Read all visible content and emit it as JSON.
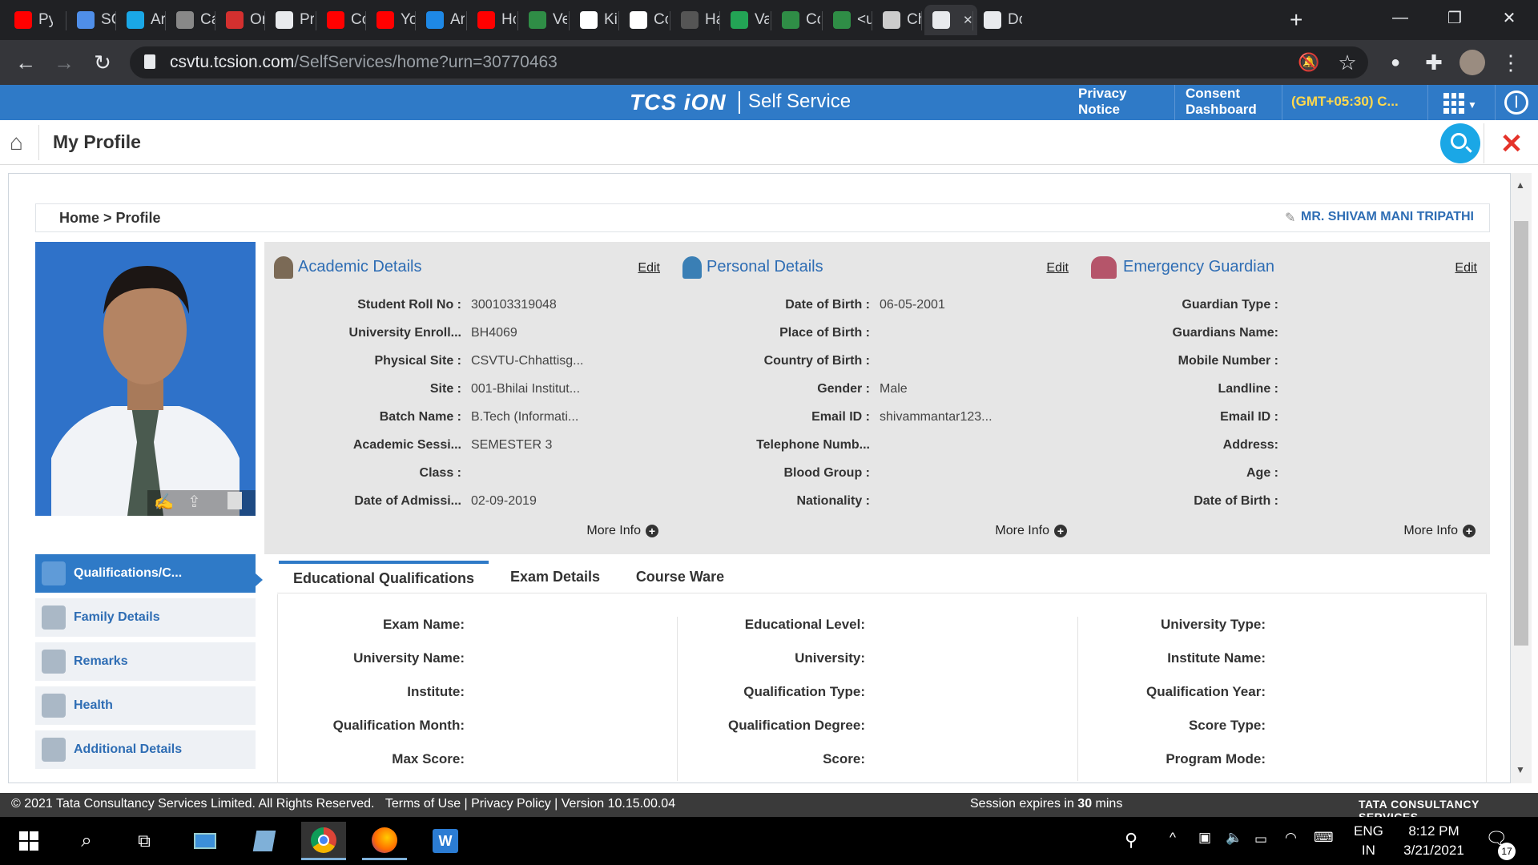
{
  "browser": {
    "tabs": [
      {
        "label": "Py",
        "color": "#ff0000"
      },
      {
        "label": "SC",
        "color": "#4f8ee8"
      },
      {
        "label": "Ar",
        "color": "#1aa7e6"
      },
      {
        "label": "Ca",
        "color": "#888888"
      },
      {
        "label": "Or",
        "color": "#d3302f"
      },
      {
        "label": "Pr",
        "color": "#e8eaed"
      },
      {
        "label": "Co",
        "color": "#ff0000"
      },
      {
        "label": "Yo",
        "color": "#ff0000"
      },
      {
        "label": "Ar",
        "color": "#1e88e5"
      },
      {
        "label": "Hc",
        "color": "#ff0000"
      },
      {
        "label": "Ve",
        "color": "#2f8d46"
      },
      {
        "label": "Ki",
        "color": "#ffffff"
      },
      {
        "label": "Cc",
        "color": "#ffffff"
      },
      {
        "label": "Ha",
        "color": "#555555"
      },
      {
        "label": "Va",
        "color": "#23a455"
      },
      {
        "label": "Cc",
        "color": "#2f8d46"
      },
      {
        "label": "<u",
        "color": "#2f8d46"
      },
      {
        "label": "Ch",
        "color": "#cccccc"
      },
      {
        "label": "",
        "color": "#e8eaed",
        "active": true
      },
      {
        "label": "Dc",
        "color": "#e8eaed"
      }
    ],
    "new_tab": "+",
    "window_controls": {
      "minimize": "—",
      "restore": "❐",
      "close": "✕"
    },
    "url_host": "csvtu.tcsion.com",
    "url_path": "/SelfServices/home?urn=30770463"
  },
  "header": {
    "brand": "TCS iON",
    "service": "Self Service",
    "privacy_line1": "Privacy",
    "privacy_line2": "Notice",
    "consent_line1": "Consent",
    "consent_line2": "Dashboard",
    "timezone": "(GMT+05:30) C..."
  },
  "page": {
    "title": "My Profile",
    "breadcrumb": "Home > Profile",
    "user": "MR. SHIVAM MANI TRIPATHI"
  },
  "panels": {
    "academic": {
      "title": "Academic Details",
      "edit": "Edit",
      "rows": [
        {
          "label": "Student Roll No :",
          "value": "300103319048"
        },
        {
          "label": "University Enroll...",
          "value": "BH4069"
        },
        {
          "label": "Physical Site :",
          "value": "CSVTU-Chhattisg..."
        },
        {
          "label": "Site :",
          "value": "001-Bhilai Institut..."
        },
        {
          "label": "Batch Name :",
          "value": "B.Tech (Informati..."
        },
        {
          "label": "Academic Sessi...",
          "value": "SEMESTER 3"
        },
        {
          "label": "Class :",
          "value": ""
        },
        {
          "label": "Date of Admissi...",
          "value": "02-09-2019"
        }
      ],
      "more": "More Info"
    },
    "personal": {
      "title": "Personal Details",
      "edit": "Edit",
      "rows": [
        {
          "label": "Date of Birth :",
          "value": "06-05-2001"
        },
        {
          "label": "Place of Birth :",
          "value": ""
        },
        {
          "label": "Country of Birth :",
          "value": ""
        },
        {
          "label": "Gender :",
          "value": "Male"
        },
        {
          "label": "Email ID :",
          "value": "shivammantar123..."
        },
        {
          "label": "Telephone Numb...",
          "value": ""
        },
        {
          "label": "Blood Group :",
          "value": ""
        },
        {
          "label": "Nationality :",
          "value": ""
        }
      ],
      "more": "More Info"
    },
    "guardian": {
      "title": "Emergency Guardian",
      "edit": "Edit",
      "rows": [
        {
          "label": "Guardian Type :",
          "value": ""
        },
        {
          "label": "Guardians Name:",
          "value": ""
        },
        {
          "label": "Mobile Number :",
          "value": ""
        },
        {
          "label": "Landline :",
          "value": ""
        },
        {
          "label": "Email ID :",
          "value": ""
        },
        {
          "label": "Address:",
          "value": ""
        },
        {
          "label": "Age :",
          "value": ""
        },
        {
          "label": "Date of Birth :",
          "value": ""
        }
      ],
      "more": "More Info"
    }
  },
  "sidenav": [
    {
      "label": "Qualifications/C...",
      "active": true
    },
    {
      "label": "Family Details"
    },
    {
      "label": "Remarks"
    },
    {
      "label": "Health"
    },
    {
      "label": "Additional Details"
    }
  ],
  "tabs": [
    "Educational Qualifications",
    "Exam Details",
    "Course Ware"
  ],
  "qualification_fields": [
    [
      "Exam Name:",
      "Educational Level:",
      "University Type:"
    ],
    [
      "University Name:",
      "University:",
      "Institute Name:"
    ],
    [
      "Institute:",
      "Qualification Type:",
      "Qualification Year:"
    ],
    [
      "Qualification Month:",
      "Qualification Degree:",
      "Score Type:"
    ],
    [
      "Max Score:",
      "Score:",
      "Program Mode:"
    ]
  ],
  "footer": {
    "copyright": "© 2021 Tata Consultancy Services Limited. All Rights Reserved.",
    "links": "Terms of Use | Privacy Policy | Version 10.15.00.04",
    "session_prefix": "Session expires in ",
    "session_value": "30",
    "session_suffix": " mins",
    "brand": "TATA CONSULTANCY SERVICES"
  },
  "taskbar": {
    "lang1": "ENG",
    "lang2": "IN",
    "time": "8:12 PM",
    "date": "3/21/2021",
    "notifications": "17"
  }
}
